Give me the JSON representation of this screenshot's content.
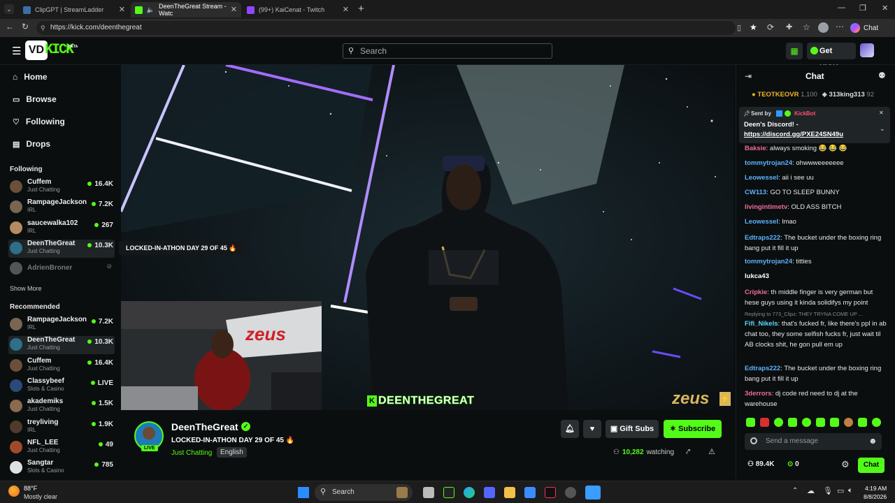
{
  "browser": {
    "tabs": [
      {
        "label": "ClipGPT | StreamLadder",
        "color": "#3b6ea8"
      },
      {
        "label": "DeenTheGreat Stream - Watc",
        "color": "#53fc18"
      },
      {
        "label": "(99+) KaiCenat - Twitch",
        "color": "#9146ff"
      }
    ],
    "url": "https://kick.com/deenthegreat",
    "chat_button": "Chat"
  },
  "kick": {
    "logo_text": "KICK",
    "logo_badge": "BETA",
    "logo_overlay": "VD",
    "search_placeholder": "Search",
    "get_kicks": "Get KICKs",
    "accent": "#53fc18"
  },
  "sidebar": {
    "nav": [
      {
        "label": "Home",
        "icon": "home-icon"
      },
      {
        "label": "Browse",
        "icon": "browse-icon"
      },
      {
        "label": "Following",
        "icon": "heart-icon"
      },
      {
        "label": "Drops",
        "icon": "drops-icon"
      }
    ],
    "following_title": "Following",
    "following": [
      {
        "name": "Cuffem",
        "category": "Just Chatting",
        "viewers": "16.4K",
        "color": "#6b4f3a"
      },
      {
        "name": "RampageJackson",
        "category": "IRL",
        "viewers": "7.2K",
        "color": "#7a6550"
      },
      {
        "name": "saucewalka102",
        "category": "IRL",
        "viewers": "267",
        "color": "#b58b63"
      },
      {
        "name": "DeenTheGreat",
        "category": "Just Chatting",
        "viewers": "10.3K",
        "color": "#2e6f8a"
      },
      {
        "name": "AdrienBroner",
        "category": "",
        "viewers": "",
        "color": "#555555"
      }
    ],
    "show_more": "Show More",
    "recommended_title": "Recommended",
    "recommended": [
      {
        "name": "RampageJackson",
        "category": "IRL",
        "viewers": "7.2K",
        "color": "#7a6550"
      },
      {
        "name": "DeenTheGreat",
        "category": "Just Chatting",
        "viewers": "10.3K",
        "color": "#2e6f8a"
      },
      {
        "name": "Cuffem",
        "category": "Just Chatting",
        "viewers": "16.4K",
        "color": "#6b4f3a"
      },
      {
        "name": "Classybeef",
        "category": "Slots & Casino",
        "viewers": "LIVE",
        "color": "#2b4a7a"
      },
      {
        "name": "akademiks",
        "category": "Just Chatting",
        "viewers": "1.5K",
        "color": "#8a6a50"
      },
      {
        "name": "treyliving",
        "category": "IRL",
        "viewers": "1.9K",
        "color": "#4f3a2b"
      },
      {
        "name": "NFL_LEE",
        "category": "Just Chatting",
        "viewers": "49",
        "color": "#a04a2a"
      },
      {
        "name": "Sangtar",
        "category": "Slots & Casino",
        "viewers": "785",
        "color": "#e0e0e0"
      }
    ]
  },
  "video": {
    "overlay_title": "LOCKED-IN-ATHON DAY 29 OF 45 🔥",
    "watermark_name": "DEENTHEGREAT",
    "sponsor": "zeus",
    "facecam_sign": "zeus"
  },
  "stream": {
    "name": "DeenTheGreat",
    "title": "LOCKED-IN-ATHON DAY 29 OF 45 🔥",
    "category": "Just Chatting",
    "language": "English",
    "live_badge": "LIVE",
    "gift_subs": "Gift Subs",
    "subscribe": "Subscribe",
    "watching_count": "10,282",
    "watching_label": "watching"
  },
  "chat": {
    "title": "Chat",
    "leaderboard": [
      {
        "name": "TEOTKEOVR",
        "value": "1,100"
      },
      {
        "name": "313king313",
        "value": "92"
      }
    ],
    "pinned": {
      "sent_by": "Sent by",
      "bot": "KickBot",
      "text": "Deen's Discord! -",
      "link": "https://discord.gg/PXE24SN49u"
    },
    "messages": [
      {
        "user": "Baksie",
        "text": "always smoking 😂 😂 😂",
        "color": "#f06ba0"
      },
      {
        "user": "tommytrojan24",
        "text": "ohwwweeeeeee",
        "color": "#5bb2ff"
      },
      {
        "user": "Leowessel",
        "text": "aii i see uu",
        "color": "#5bb2ff"
      },
      {
        "user": "CW113",
        "text": "GO TO SLEEP BUNNY",
        "color": "#5bb2ff"
      },
      {
        "user": "livingintimetv",
        "text": "OLD ASS BITCH",
        "color": "#f06ba0"
      },
      {
        "user": "Leowessel",
        "text": "lmao",
        "color": "#5bb2ff"
      },
      {
        "user": "Edtraps222",
        "text": "The bucket under the boxing ring bang put it fill it up",
        "color": "#5bb2ff"
      },
      {
        "user": "tommytrojan24",
        "text": "titties",
        "color": "#5bb2ff"
      },
      {
        "user": "lukca43",
        "text": "",
        "color": "#ffffff"
      },
      {
        "user": "Cripkie",
        "text": "th middle finger is very german but hese guys using it kinda solidifys my point",
        "color": "#f06ba0"
      },
      {
        "user": "Fifi_Nikels",
        "text": "that's fucked fr, like there's ppl in ab chat too, they some selfish fucks fr, just wait til AB clocks shit, he gon pull em up",
        "color": "#5bdbff"
      },
      {
        "user": "Edtraps222",
        "text": "The bucket under the boxing ring bang put it fill it up",
        "color": "#5bb2ff"
      },
      {
        "user": "3derrors",
        "text": "dj code red need to dj at the warehouse",
        "color": "#f06ba0"
      }
    ],
    "reply_hint": "Replying to 773_Clipz: THEY TRYNA COME UP ...",
    "input_placeholder": "Send a message",
    "followers": "89.4K",
    "kicks": "0",
    "chat_button": "Chat"
  },
  "taskbar": {
    "weather_temp": "88°F",
    "weather_desc": "Mostly clear",
    "search": "Search",
    "time": "4:19 AM",
    "date": "8/8/2026"
  }
}
